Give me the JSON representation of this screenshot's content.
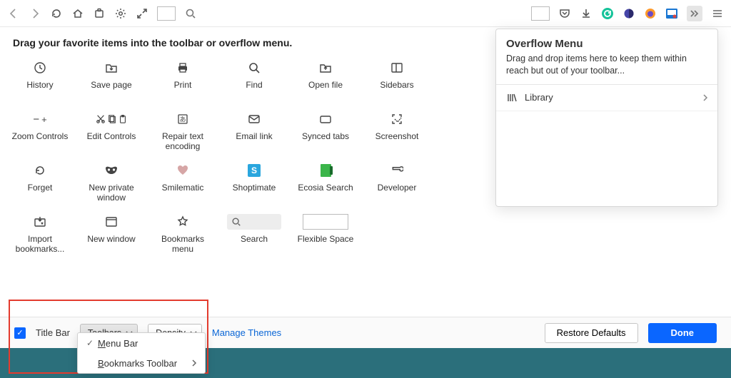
{
  "instruction_text": "Drag your favorite items into the toolbar or overflow menu.",
  "overflow": {
    "title": "Overflow Menu",
    "desc": "Drag and drop items here to keep them within reach but out of your toolbar...",
    "items": [
      {
        "label": "Library",
        "icon": "library-icon",
        "has_submenu": true
      }
    ]
  },
  "grid_items": [
    {
      "label": "History",
      "icon": "clock"
    },
    {
      "label": "Save page",
      "icon": "folder-down"
    },
    {
      "label": "Print",
      "icon": "printer"
    },
    {
      "label": "Find",
      "icon": "search"
    },
    {
      "label": "Open file",
      "icon": "folder-open"
    },
    {
      "label": "Sidebars",
      "icon": "sidebar-split"
    },
    {
      "label": "Zoom Controls",
      "icon": "minus-plus"
    },
    {
      "label": "Edit Controls",
      "icon": "cut-copy-paste"
    },
    {
      "label": "Repair text encoding",
      "icon": "char-box"
    },
    {
      "label": "Email link",
      "icon": "envelope"
    },
    {
      "label": "Synced tabs",
      "icon": "tab"
    },
    {
      "label": "Screenshot",
      "icon": "crop-marks"
    },
    {
      "label": "Forget",
      "icon": "undo-clock"
    },
    {
      "label": "New private window",
      "icon": "mask"
    },
    {
      "label": "Smilematic",
      "icon": "heart"
    },
    {
      "label": "Shoptimate",
      "icon": "badge-s"
    },
    {
      "label": "Ecosia Search",
      "icon": "badge-e"
    },
    {
      "label": "Developer",
      "icon": "wrench"
    },
    {
      "label": "Import bookmarks...",
      "icon": "import-star"
    },
    {
      "label": "New window",
      "icon": "window"
    },
    {
      "label": "Bookmarks menu",
      "icon": "star"
    },
    {
      "label": "Search",
      "icon": "search-slot"
    },
    {
      "label": "Flexible Space",
      "icon": "flex-slot"
    }
  ],
  "bottom": {
    "titlebar_label": "Title Bar",
    "titlebar_checked": true,
    "toolbars_label": "Toolbars",
    "density_label": "Density",
    "manage_themes": "Manage Themes",
    "restore": "Restore Defaults",
    "done": "Done",
    "popup_items": [
      {
        "label_prefix": "",
        "underline": "M",
        "label_suffix": "enu Bar",
        "checked": true,
        "submenu": false
      },
      {
        "label_prefix": "",
        "underline": "B",
        "label_suffix": "ookmarks Toolbar",
        "checked": false,
        "submenu": true
      }
    ]
  },
  "topbar_icons": [
    "back",
    "forward",
    "reload",
    "home",
    "extensions",
    "settings",
    "fullscreen",
    "square",
    "search"
  ],
  "topbar_right": [
    "square",
    "pocket",
    "download",
    "grammarly",
    "otto",
    "firefox",
    "accent",
    "save-blue",
    "overflow",
    "menu"
  ]
}
